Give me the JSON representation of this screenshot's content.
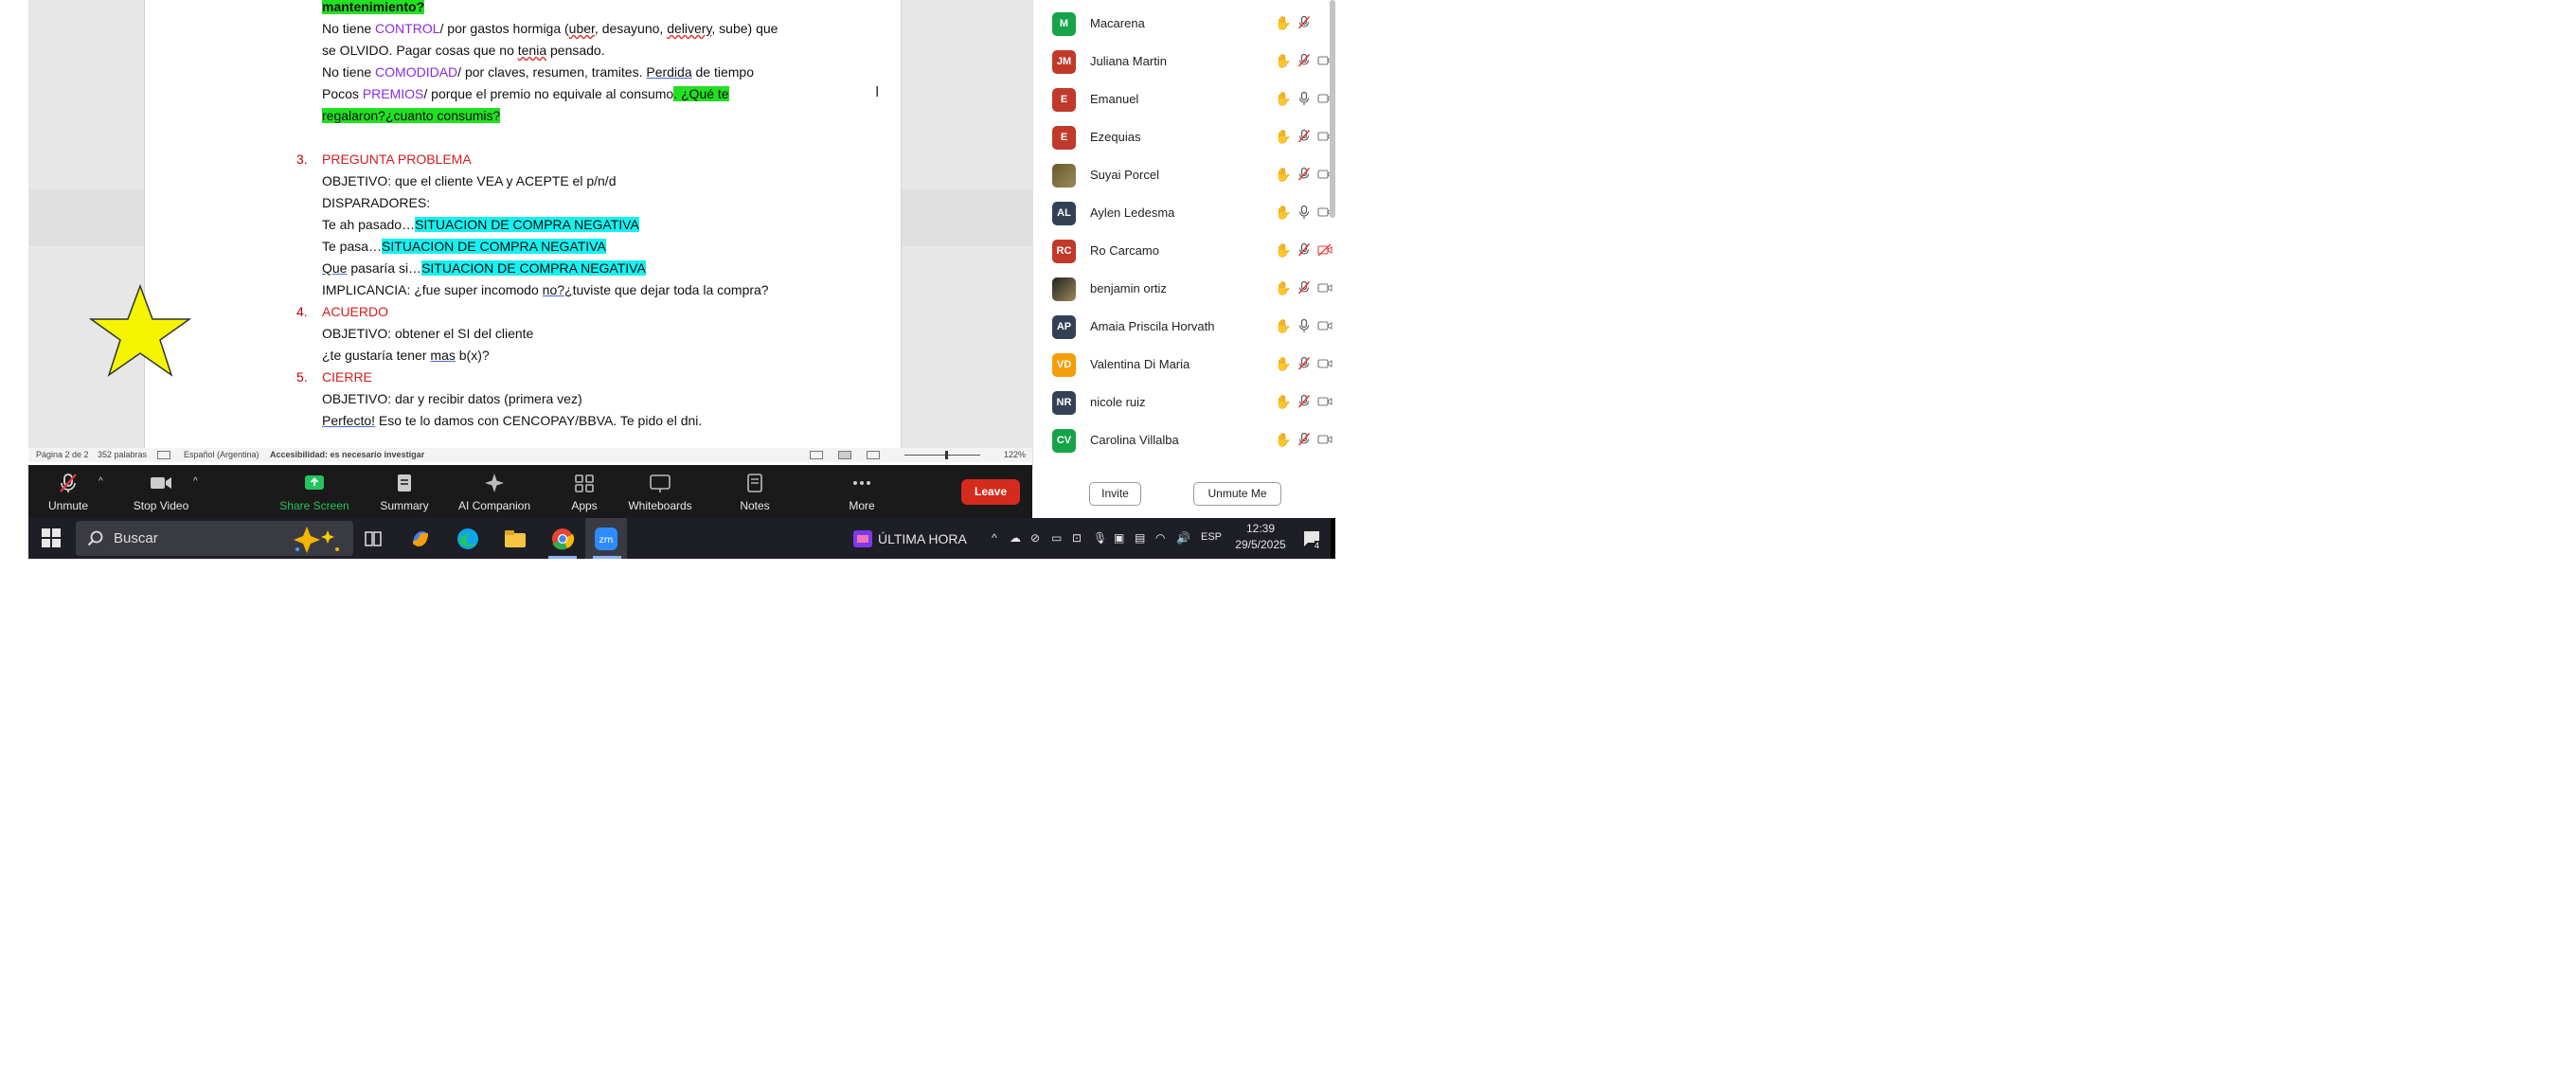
{
  "document": {
    "lines": {
      "l0": "mantenimiento?",
      "l1a": "No tiene ",
      "l1b": "CONTROL",
      "l1c": "/ por gastos hormiga (",
      "l1d": "uber",
      "l1e": ", desayuno, ",
      "l1f": "delivery",
      "l1g": ", sube) que",
      "l2": "se OLVIDO. Pagar cosas que no ",
      "l2b": "tenia",
      "l2c": " pensado.",
      "l3a": "No tiene ",
      "l3b": "COMODIDAD",
      "l3c": "/ por claves, resumen, tramites. ",
      "l3d": "Perdida",
      "l3e": " de tiempo",
      "l4a": "Pocos ",
      "l4b": "PREMIOS",
      "l4c": "/ porque el premio no equivale al consumo",
      "l4d": ". ¿Qué te",
      "l5": "regalaron?¿cuanto consumis?",
      "s3num": "3.",
      "s3title": "PREGUNTA PROBLEMA",
      "s3obj": "OBJETIVO: que el cliente VEA y ACEPTE el p/n/d",
      "s3disp": "DISPARADORES:",
      "t1a": "Te ah pasado…",
      "t1b": "SITUACION DE COMPRA NEGATIVA",
      "t2a": "Te pasa…",
      "t2b": "SITUACION DE COMPRA NEGATIVA",
      "t3a": "Que",
      "t3b": " pasaría si…",
      "t3c": "SITUACION DE COMPRA NEGATIVA",
      "impa": "IMPLICANCIA: ¿fue super incomodo ",
      "impb": "no?¿",
      "impc": "tuviste que dejar toda la compra?",
      "s4num": "4.",
      "s4title": "ACUERDO",
      "s4obj": "OBJETIVO: obtener el SI del cliente",
      "s4qa": "¿te gustaría tener ",
      "s4qb": "mas",
      "s4qc": " b(x)?",
      "s5num": "5.",
      "s5title": "CIERRE",
      "s5obj": "OBJETIVO: dar y recibir datos (primera vez)",
      "s5la": "Perfecto!",
      "s5lb": " Eso te lo damos con CENCOPAY/BBVA. Te pido el dni."
    },
    "status": {
      "page": "Página 2 de 2",
      "words": "352 palabras",
      "lang": "Español (Argentina)",
      "accessibility": "Accesibilidad: es necesario investigar",
      "zoom": "122%"
    }
  },
  "toolbar": {
    "unmute": "Unmute",
    "stop_video": "Stop Video",
    "share_screen": "Share Screen",
    "summary": "Summary",
    "ai_companion": "AI Companion",
    "apps": "Apps",
    "whiteboards": "Whiteboards",
    "notes": "Notes",
    "more": "More",
    "leave": "Leave",
    "share_color": "#22c55e",
    "leave_color": "#d52b1e"
  },
  "participants": [
    {
      "initials": "M",
      "name": "Macarena",
      "color": "#16a34a",
      "mic": "muted",
      "cam": "none"
    },
    {
      "initials": "JM",
      "name": "Juliana Martin",
      "color": "#c0392b",
      "mic": "muted",
      "cam": "off"
    },
    {
      "initials": "E",
      "name": "Emanuel",
      "color": "#c0392b",
      "mic": "on",
      "cam": "off"
    },
    {
      "initials": "E",
      "name": "Ezequias",
      "color": "#c0392b",
      "mic": "muted",
      "cam": "off"
    },
    {
      "initials": "",
      "name": "Suyai Porcel",
      "color": "#6b5a2a",
      "mic": "muted",
      "cam": "off"
    },
    {
      "initials": "AL",
      "name": "Aylen Ledesma",
      "color": "#334155",
      "mic": "on",
      "cam": "off"
    },
    {
      "initials": "RC",
      "name": "Ro Carcamo",
      "color": "#c0392b",
      "mic": "muted",
      "cam": "blocked"
    },
    {
      "initials": "",
      "name": "benjamin ortiz",
      "color": "#222222",
      "mic": "muted",
      "cam": "off"
    },
    {
      "initials": "AP",
      "name": "Amaia Priscila Horvath",
      "color": "#334155",
      "mic": "on",
      "cam": "off"
    },
    {
      "initials": "VD",
      "name": "Valentina Di Maria",
      "color": "#f59e0b",
      "mic": "muted",
      "cam": "off"
    },
    {
      "initials": "NR",
      "name": "nicole ruiz",
      "color": "#334155",
      "mic": "muted",
      "cam": "off"
    },
    {
      "initials": "CV",
      "name": "Carolina Villalba",
      "color": "#16a34a",
      "mic": "muted",
      "cam": "off"
    }
  ],
  "panel": {
    "invite": "Invite",
    "unmute_me": "Unmute Me"
  },
  "taskbar": {
    "search_placeholder": "Buscar",
    "news": "ÚLTIMA HORA",
    "lang": "ESP",
    "time": "12:39",
    "date": "29/5/2025",
    "notif_count": "4",
    "icons": [
      "windows-start-icon",
      "search-icon",
      "copilot-sparkle-icon",
      "task-view-icon",
      "copilot-icon",
      "edge-icon",
      "file-explorer-icon",
      "chrome-icon",
      "zoom-icon"
    ]
  }
}
